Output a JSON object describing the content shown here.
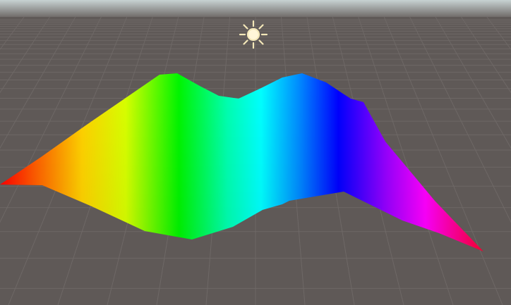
{
  "scene": {
    "view": "scene-view",
    "sky_color_top": "#c7d2d2",
    "sky_color_bottom": "#6a6462",
    "ground_color": "#5f5957",
    "grid_color": "#6f6967",
    "light_gizmo_icon": "sun-icon",
    "light_gizmo_color": "#f3e7b8",
    "mesh": {
      "name": "rainbow-terrain-mesh",
      "gradient": [
        "#ff0000",
        "#ffff00",
        "#00ff00",
        "#00ffff",
        "#0000ff",
        "#ff00ff",
        "#ff0000"
      ]
    }
  }
}
